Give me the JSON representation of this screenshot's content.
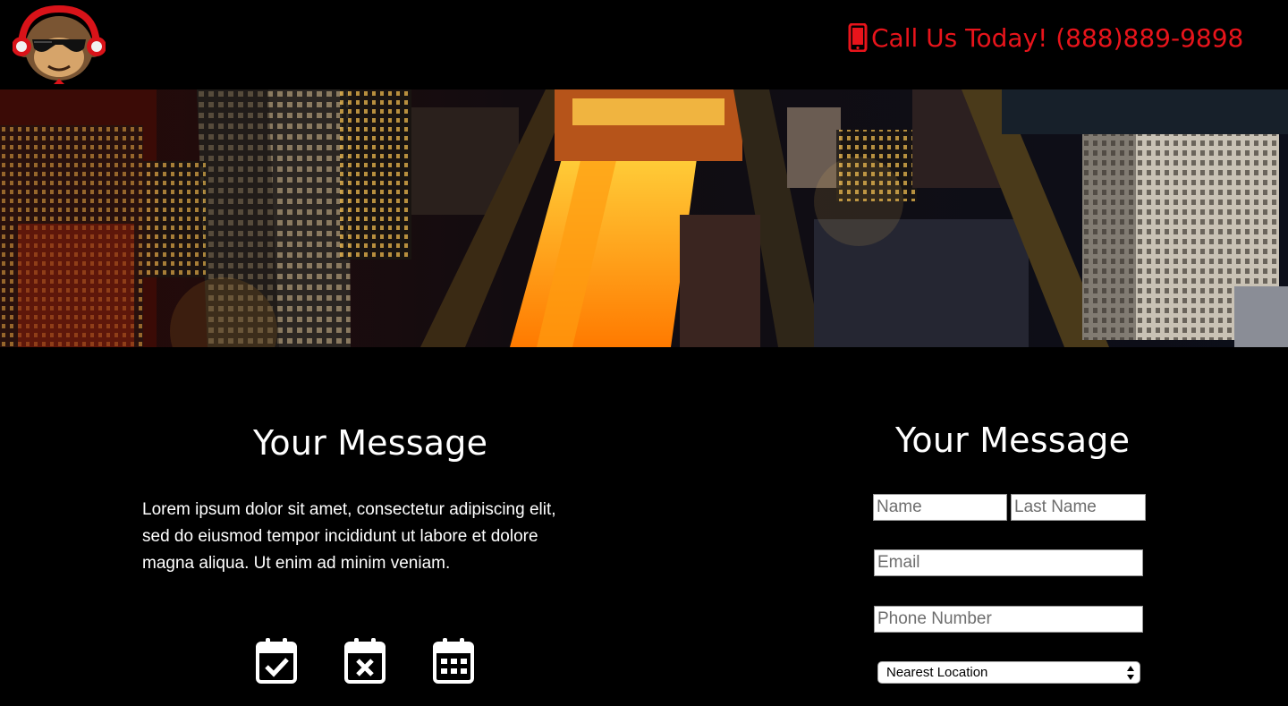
{
  "header": {
    "logo_icon": "monkey-headphones-logo-icon",
    "call_icon": "mobile-phone-icon",
    "call_text": "Call Us Today! (888)889-9898",
    "accent_color": "#e8141b"
  },
  "hero": {
    "image": "night-city-aerial-photo"
  },
  "left": {
    "title": "Your Message",
    "body": "Lorem ipsum dolor sit amet, consectetur adipiscing elit, sed do eiusmod tempor incididunt ut labore et dolore magna aliqua. Ut enim ad minim veniam.",
    "icons": [
      "calendar-check-icon",
      "calendar-x-icon",
      "calendar-grid-icon"
    ]
  },
  "form": {
    "title": "Your Message",
    "name_placeholder": "Name",
    "last_name_placeholder": "Last Name",
    "email_placeholder": "Email",
    "phone_placeholder": "Phone Number",
    "location_selected": "Nearest Location"
  }
}
